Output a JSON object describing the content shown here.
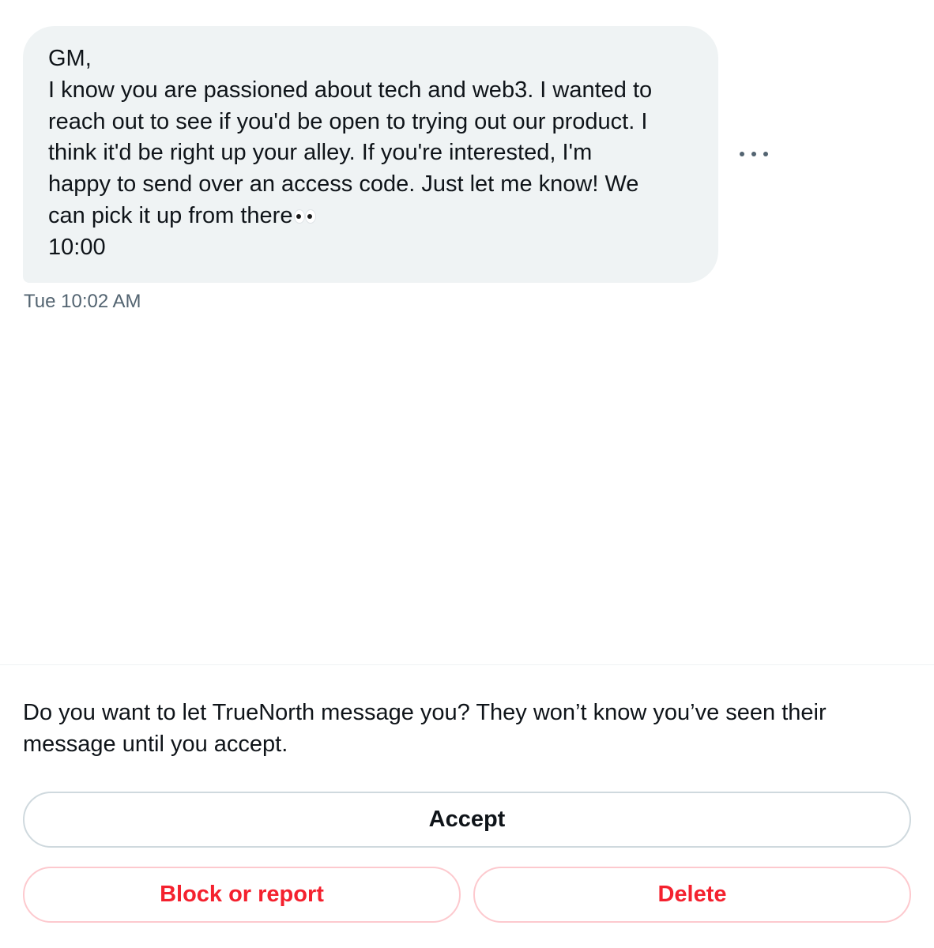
{
  "message": {
    "lines": [
      "GM,",
      "I know you are passioned about tech and web3. I wanted to",
      "reach out to see if you'd be open to trying out our product. I",
      "think it'd be right up your alley. If you're interested, I'm",
      "happy to send over an access code. Just let me know! We",
      "can pick it up from there",
      "10:00"
    ],
    "trailing_emoji": "eyes-emoji",
    "timestamp": "Tue 10:02 AM"
  },
  "more_options_icon": "more-horizontal-icon",
  "request": {
    "prompt": "Do you want to let TrueNorth message you? They won’t know you’ve seen their message until you accept.",
    "accept_label": "Accept",
    "block_label": "Block or report",
    "delete_label": "Delete"
  },
  "colors": {
    "bubble_bg": "#eff3f4",
    "text": "#0f1419",
    "secondary_text": "#536471",
    "danger": "#f4212e",
    "border": "#cfd9de",
    "danger_border": "#fdc9ce"
  }
}
